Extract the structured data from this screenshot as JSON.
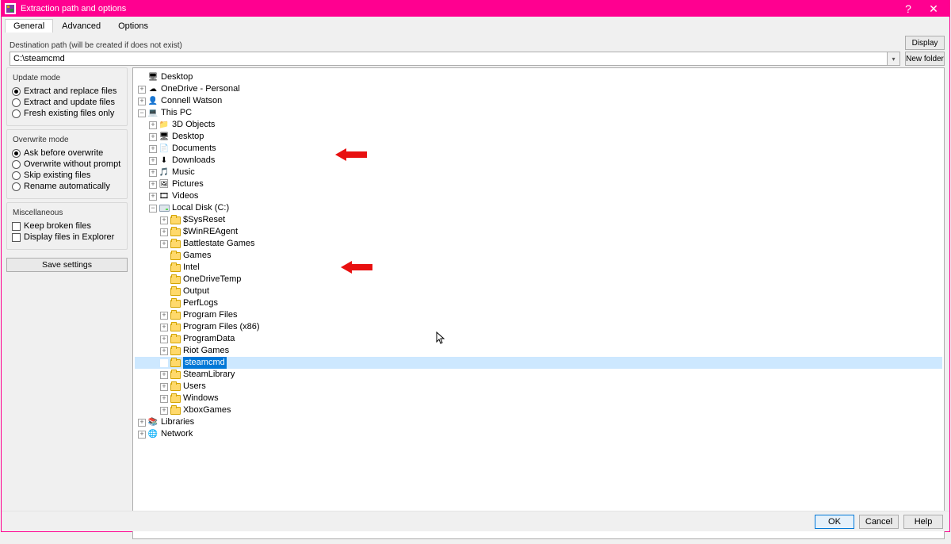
{
  "window": {
    "title": "Extraction path and options",
    "help_label": "?",
    "close_label": "✕"
  },
  "tabs": {
    "general": "General",
    "advanced": "Advanced",
    "options": "Options",
    "active": "General"
  },
  "dest": {
    "label": "Destination path (will be created if does not exist)",
    "value": "C:\\steamcmd",
    "display_btn": "Display",
    "newfolder_btn": "New folder"
  },
  "update_mode": {
    "legend": "Update mode",
    "items": [
      {
        "label": "Extract and replace files",
        "selected": true
      },
      {
        "label": "Extract and update files",
        "selected": false
      },
      {
        "label": "Fresh existing files only",
        "selected": false
      }
    ]
  },
  "overwrite_mode": {
    "legend": "Overwrite mode",
    "items": [
      {
        "label": "Ask before overwrite",
        "selected": true
      },
      {
        "label": "Overwrite without prompt",
        "selected": false
      },
      {
        "label": "Skip existing files",
        "selected": false
      },
      {
        "label": "Rename automatically",
        "selected": false
      }
    ]
  },
  "misc": {
    "legend": "Miscellaneous",
    "items": [
      {
        "label": "Keep broken files",
        "checked": false
      },
      {
        "label": "Display files in Explorer",
        "checked": false
      }
    ]
  },
  "save_settings": "Save settings",
  "tree": {
    "desktop": "Desktop",
    "onedrive": "OneDrive - Personal",
    "user": "Connell Watson",
    "thispc": "This PC",
    "pc_children": [
      {
        "label": "3D Objects",
        "icon": "folder-blue"
      },
      {
        "label": "Desktop",
        "icon": "folder-blue"
      },
      {
        "label": "Documents",
        "icon": "folder-docs"
      },
      {
        "label": "Downloads",
        "icon": "folder-down"
      },
      {
        "label": "Music",
        "icon": "music"
      },
      {
        "label": "Pictures",
        "icon": "pictures"
      },
      {
        "label": "Videos",
        "icon": "videos"
      }
    ],
    "localdisk": "Local Disk (C:)",
    "c_children": [
      "$SysReset",
      "$WinREAgent",
      "Battlestate Games",
      "Games",
      "Intel",
      "OneDriveTemp",
      "Output",
      "PerfLogs",
      "Program Files",
      "Program Files (x86)",
      "ProgramData",
      "Riot Games",
      "steamcmd",
      "SteamLibrary",
      "Users",
      "Windows",
      "XboxGames"
    ],
    "selected": "steamcmd",
    "libraries": "Libraries",
    "network": "Network"
  },
  "footer": {
    "ok": "OK",
    "cancel": "Cancel",
    "help": "Help"
  },
  "icons": {
    "desktop": "🖥",
    "cloud": "☁",
    "user": "👤",
    "pc": "💻",
    "blue_folder": "📁",
    "docs": "📄",
    "down": "⬇",
    "music": "🎵",
    "pic": "🖼",
    "vid": "🎞",
    "lib": "📚",
    "net": "🌐"
  }
}
